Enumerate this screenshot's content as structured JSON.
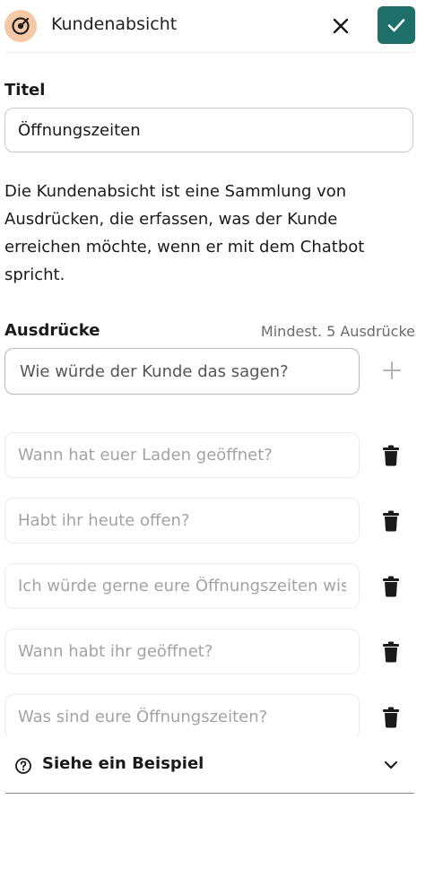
{
  "header": {
    "title": "Kundenabsicht",
    "logo_icon": "target-icon",
    "close_icon": "close-icon",
    "confirm_icon": "check-icon",
    "accent_color": "#1e6f6a",
    "logo_bg_color": "#f6c9a6"
  },
  "title_section": {
    "label": "Titel",
    "value": "Öffnungszeiten"
  },
  "description": "Die Kundenabsicht ist eine Sammlung von Ausdrücken, die erfassen, was der Kunde erreichen möchte, wenn er mit dem Chatbot spricht.",
  "expressions_section": {
    "label": "Ausdrücke",
    "hint": "Mindest. 5 Ausdrücke",
    "input_placeholder": "Wie würde der Kunde das sagen?",
    "add_icon": "plus-icon",
    "delete_icon": "trash-icon",
    "items": [
      "Wann hat euer Laden geöffnet?",
      "Habt ihr heute offen?",
      "Ich würde gerne eure Öffnungszeiten wissen",
      "Wann habt ihr geöffnet?",
      "Was sind eure Öffnungszeiten?"
    ]
  },
  "example": {
    "label": "Siehe ein Beispiel",
    "help_icon": "help-circle-icon",
    "chevron_icon": "chevron-down-icon"
  }
}
